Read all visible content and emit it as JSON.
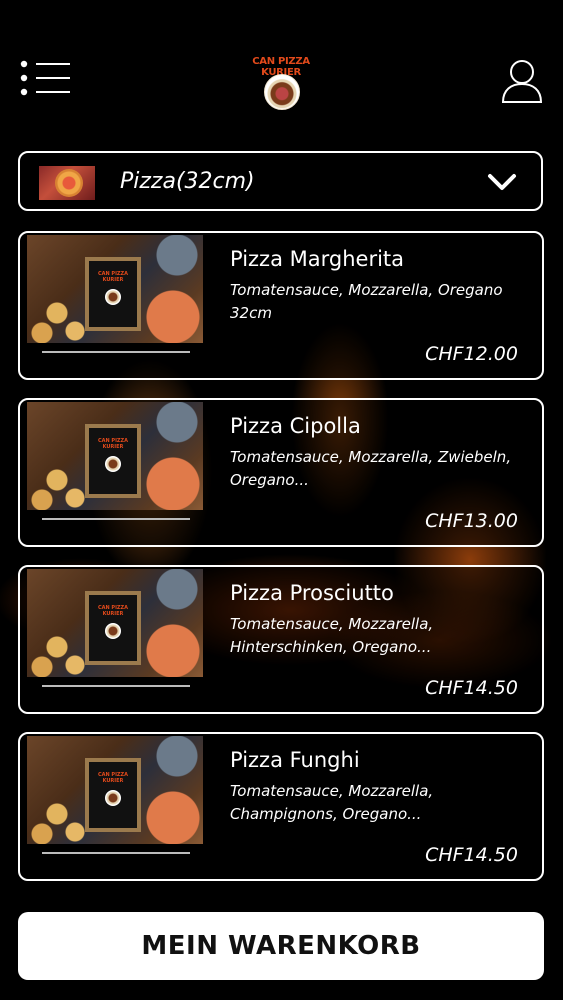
{
  "header": {
    "menu_icon": "hamburger-menu-icon",
    "logo_text": "CAN PIZZA KURIER",
    "user_icon": "user-profile-icon"
  },
  "category": {
    "label": "Pizza(32cm)",
    "chevron_icon": "chevron-down-icon"
  },
  "products": [
    {
      "name": "Pizza Margherita",
      "description": "Tomatensauce, Mozzarella, Oregano 32cm",
      "price": "CHF12.00"
    },
    {
      "name": "Pizza Cipolla",
      "description": "Tomatensauce, Mozzarella, Zwiebeln, Oregano...",
      "price": "CHF13.00"
    },
    {
      "name": "Pizza Prosciutto",
      "description": "Tomatensauce, Mozzarella, Hinterschinken, Oregano...",
      "price": "CHF14.50"
    },
    {
      "name": "Pizza Funghi",
      "description": "Tomatensauce, Mozzarella, Champignons, Oregano...",
      "price": "CHF14.50"
    }
  ],
  "cart": {
    "label": "MEIN WARENKORB"
  }
}
